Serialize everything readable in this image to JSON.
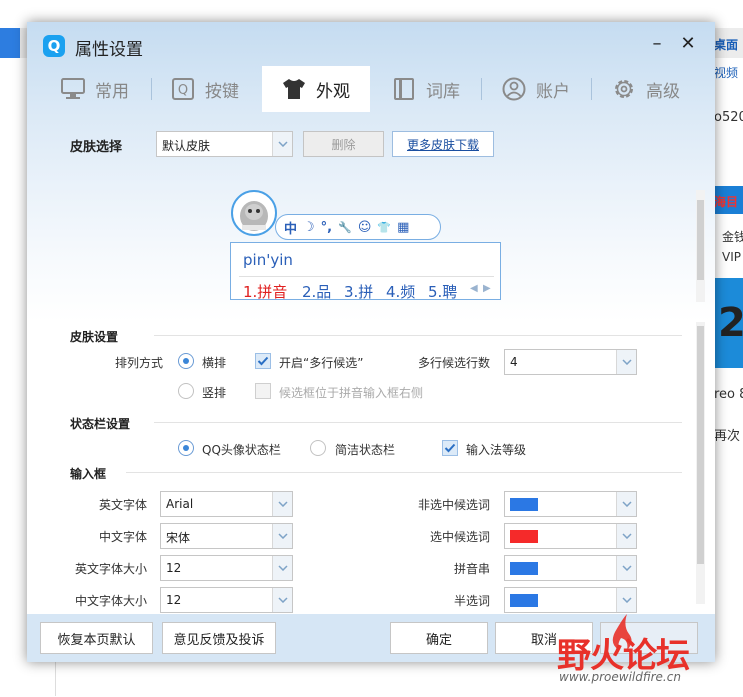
{
  "background_window": {
    "right_texts": [
      "桌面",
      "视频",
      "o520",
      "海目",
      "金钱",
      "VIP",
      "2",
      "reo 8.",
      "再次"
    ]
  },
  "dialog": {
    "title": "属性设置",
    "minimize_symbol": "–",
    "close_symbol": "✕"
  },
  "tabs": [
    {
      "label": "常用",
      "icon": "monitor-icon"
    },
    {
      "label": "按键",
      "icon": "key-icon"
    },
    {
      "label": "外观",
      "icon": "shirt-icon",
      "active": true
    },
    {
      "label": "词库",
      "icon": "book-icon"
    },
    {
      "label": "账户",
      "icon": "user-icon"
    },
    {
      "label": "高级",
      "icon": "gear-icon"
    }
  ],
  "skin_select": {
    "label": "皮肤选择",
    "value": "默认皮肤",
    "delete_label": "删除",
    "more_label": "更多皮肤下载"
  },
  "preview": {
    "toolbar_chars": [
      "中",
      "☽",
      "°,",
      "🔧",
      "☺",
      "👕",
      "▦"
    ],
    "input_text": "pin'yin",
    "candidates": [
      {
        "text": "1.拼音",
        "color": "#e02020"
      },
      {
        "text": "2.品",
        "color": "#2a5fb8"
      },
      {
        "text": "3.拼",
        "color": "#2a5fb8"
      },
      {
        "text": "4.频",
        "color": "#2a5fb8"
      },
      {
        "text": "5.聘",
        "color": "#2a5fb8"
      }
    ]
  },
  "skin_settings": {
    "title": "皮肤设置",
    "arrangement_label": "排列方式",
    "horizontal_label": "横排",
    "vertical_label": "竖排",
    "multiline_label": "开启“多行候选”",
    "multiline_rows_label": "多行候选行数",
    "multiline_rows_value": "4",
    "candidate_right_label": "候选框位于拼音输入框右侧"
  },
  "status_bar": {
    "title": "状态栏设置",
    "qq_label": "QQ头像状态栏",
    "simple_label": "简洁状态栏",
    "level_label": "输入法等级"
  },
  "input_box": {
    "title": "输入框",
    "en_font_label": "英文字体",
    "en_font_value": "Arial",
    "cn_font_label": "中文字体",
    "cn_font_value": "宋体",
    "en_size_label": "英文字体大小",
    "en_size_value": "12",
    "cn_size_label": "中文字体大小",
    "cn_size_value": "12",
    "unselected_label": "非选中候选词",
    "unselected_color": "#2b78e4",
    "selected_label": "选中候选词",
    "selected_color": "#f52a2a",
    "pinyin_label": "拼音串",
    "pinyin_color": "#2b78e4",
    "half_label": "半选词",
    "half_color": "#2b78e4"
  },
  "footer": {
    "restore_label": "恢复本页默认",
    "feedback_label": "意见反馈及投诉",
    "ok_label": "确定",
    "cancel_label": "取消",
    "apply_label": ""
  },
  "watermark": {
    "text": "野火论坛",
    "url": "www.proewildfire.cn"
  }
}
